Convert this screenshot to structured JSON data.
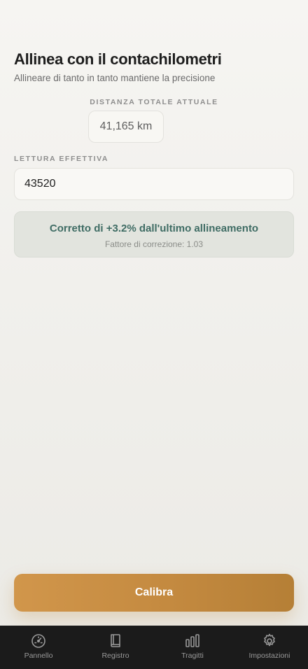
{
  "header": {
    "title": "Allinea con il contachilometri",
    "subtitle": "Allineare di tanto in tanto mantiene la precisione"
  },
  "current": {
    "label": "DISTANZA TOTALE ATTUALE",
    "value": "41,165 km"
  },
  "reading": {
    "label": "LETTURA EFFETTIVA",
    "value": "43520"
  },
  "correction": {
    "message": "Corretto di +3.2% dall'ultimo allineamento",
    "factor": "Fattore di correzione: 1.03",
    "color": "#3f6c64"
  },
  "actions": {
    "calibrate_label": "Calibra",
    "accent": "#c48a40"
  },
  "tabbar": {
    "items": [
      {
        "label": "Pannello",
        "icon": "speedometer-icon"
      },
      {
        "label": "Registro",
        "icon": "book-icon"
      },
      {
        "label": "Tragitti",
        "icon": "bar-chart-icon"
      },
      {
        "label": "Impostazioni",
        "icon": "gear-icon"
      }
    ]
  }
}
